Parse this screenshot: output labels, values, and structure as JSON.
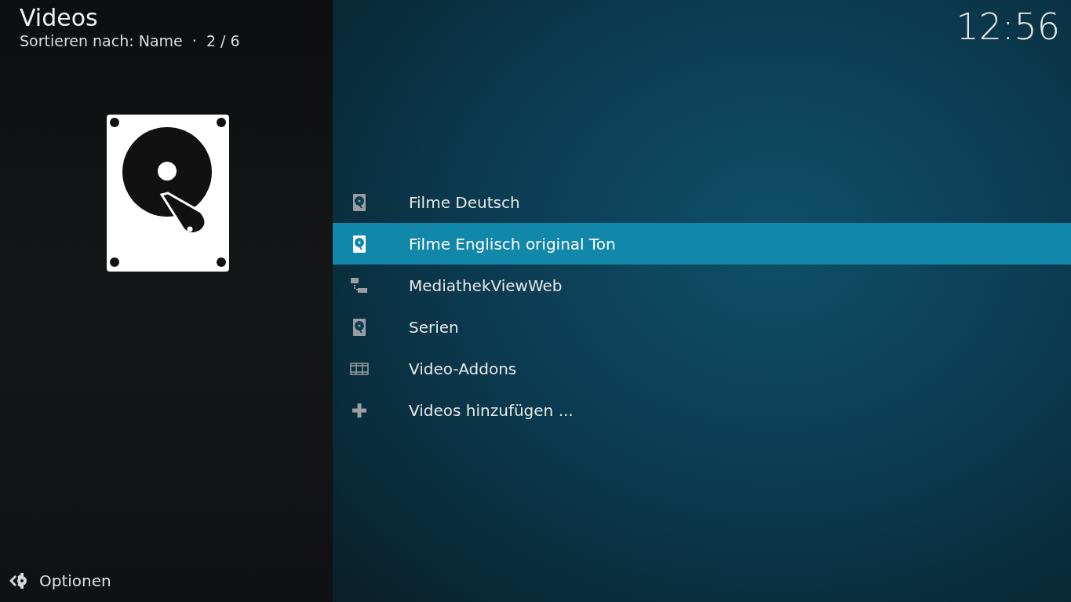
{
  "header": {
    "title": "Videos",
    "subtitle": "Sortieren nach: Name  ·  2 / 6"
  },
  "clock": "12:56",
  "items": [
    {
      "label": "Filme Deutsch",
      "kind": "harddisk",
      "selected": false
    },
    {
      "label": "Filme Englisch original Ton",
      "kind": "harddisk",
      "selected": true
    },
    {
      "label": "MediathekViewWeb",
      "kind": "network",
      "selected": false
    },
    {
      "label": "Serien",
      "kind": "harddisk",
      "selected": false
    },
    {
      "label": "Video-Addons",
      "kind": "addons",
      "selected": false
    },
    {
      "label": "Videos hinzufügen ...",
      "kind": "add",
      "selected": false
    }
  ],
  "options_button": "Optionen"
}
